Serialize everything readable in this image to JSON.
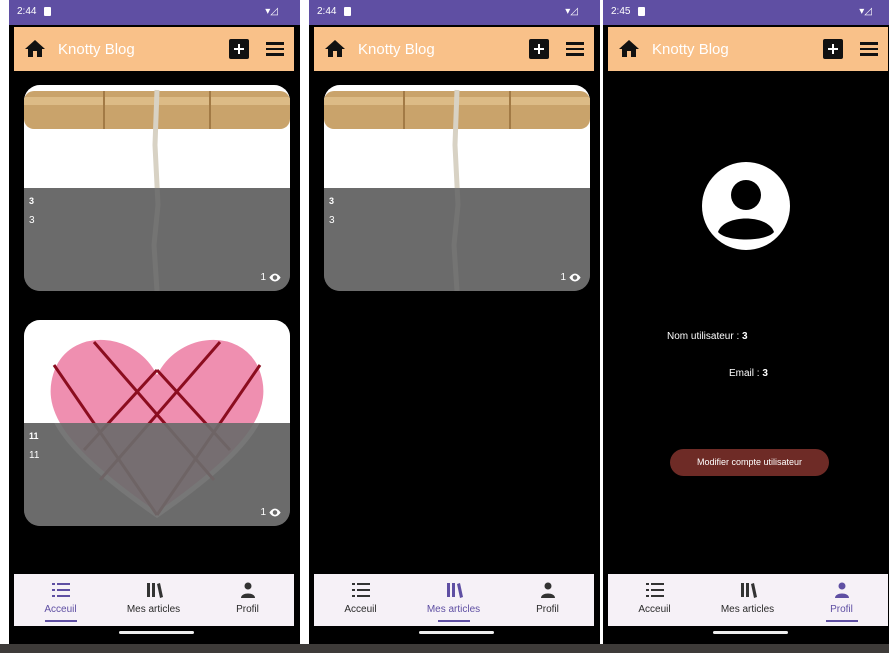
{
  "app": {
    "title": "Knotty Blog"
  },
  "screens": [
    {
      "status_time": "2:44",
      "articles": [
        {
          "title": "3",
          "subtitle": "3",
          "views": "1"
        },
        {
          "title": "11",
          "subtitle": "11",
          "views": "1"
        }
      ],
      "active_tab": "Acceuil"
    },
    {
      "status_time": "2:44",
      "articles": [
        {
          "title": "3",
          "subtitle": "3",
          "views": "1"
        }
      ],
      "active_tab": "Mes articles"
    },
    {
      "status_time": "2:45",
      "profile": {
        "username_label": "Nom utilisateur :",
        "username_value": "3",
        "email_label": "Email :",
        "email_value": "3",
        "edit_button": "Modifier compte utilisateur"
      },
      "active_tab": "Profil"
    }
  ],
  "nav": {
    "home": "Acceuil",
    "my_articles": "Mes articles",
    "profile": "Profil"
  },
  "icons": {
    "home": "home-icon",
    "add": "add-box-icon",
    "menu": "menu-icon",
    "list": "list-icon",
    "library": "library-icon",
    "person": "person-icon",
    "eye": "eye-icon",
    "avatar": "account-circle-icon"
  },
  "colors": {
    "status_bar": "#5f4fa3",
    "app_bar": "#f9c189",
    "accent": "#5f4fa3",
    "edit_button": "#6e2b26",
    "card_overlay": "#6b6b6b"
  }
}
